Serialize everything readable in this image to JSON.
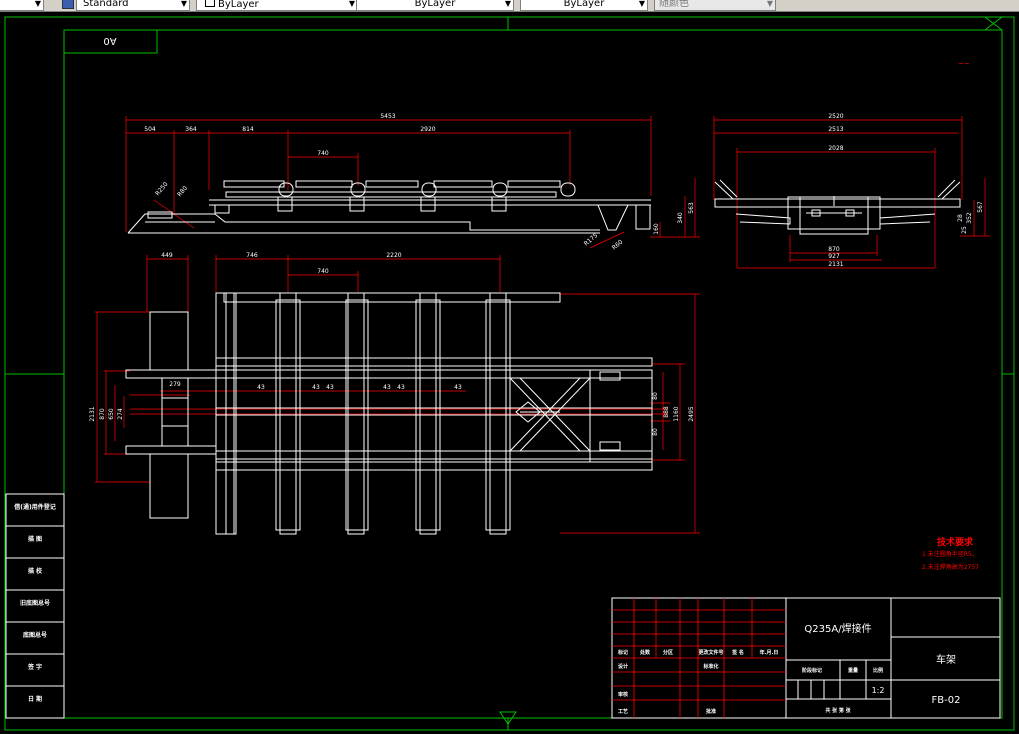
{
  "toolbar": {
    "textstyle": "Standard",
    "layer": "ByLayer",
    "linetype": "ByLayer",
    "lineweight": "ByLayer",
    "plotstyle": "随颜色"
  },
  "sheet": {
    "size_label": "A0"
  },
  "side_view": {
    "dims": {
      "overall": "5453",
      "d504": "504",
      "d364": "364",
      "d814": "814",
      "d2920": "2920",
      "d740": "740",
      "h340": "340",
      "h563": "563",
      "h160": "160",
      "r250": "R250",
      "r80": "R80",
      "r175": "R175",
      "r60": "R60"
    }
  },
  "end_view": {
    "dims": {
      "d2520": "2520",
      "d2513": "2513",
      "d2028": "2028",
      "d870": "870",
      "d927": "927",
      "d2131": "2131",
      "h567": "567",
      "h352": "352",
      "h28": "28",
      "h25": "25"
    }
  },
  "plan_view": {
    "dims": {
      "d449": "449",
      "d746": "746",
      "d740": "740",
      "d2220": "2220",
      "d43": "43",
      "d279": "279",
      "h2131": "2131",
      "h870": "870",
      "h650": "650",
      "h274": "274",
      "h2495": "2495",
      "h1160": "1160",
      "h888": "888",
      "h80a": "80",
      "h80b": "80"
    }
  },
  "tech_requirements": {
    "title": "技术要求",
    "items": [
      "1.未注圆角半径R5。",
      "2.未注焊角高为2757"
    ]
  },
  "left_stamps": [
    "借(通)用件登记",
    "描  图",
    "描  校",
    "旧底图总号",
    "底图总号",
    "签  字",
    "日  期"
  ],
  "title_block": {
    "material": "Q235A/焊接件",
    "part_name": "车架",
    "drawing_no": "FB-02",
    "scale": "1:2",
    "stage_mark": "阶段标记",
    "weight": "重量",
    "scale_label": "比例",
    "total_sheets": "共    张  第    张",
    "row_labels": [
      "标记",
      "处数",
      "分区",
      "更改文件号",
      "签  名",
      "年.月.日"
    ],
    "design": "设计",
    "standardize": "标准化",
    "review": "审核",
    "process": "工艺",
    "approve": "批准"
  }
}
